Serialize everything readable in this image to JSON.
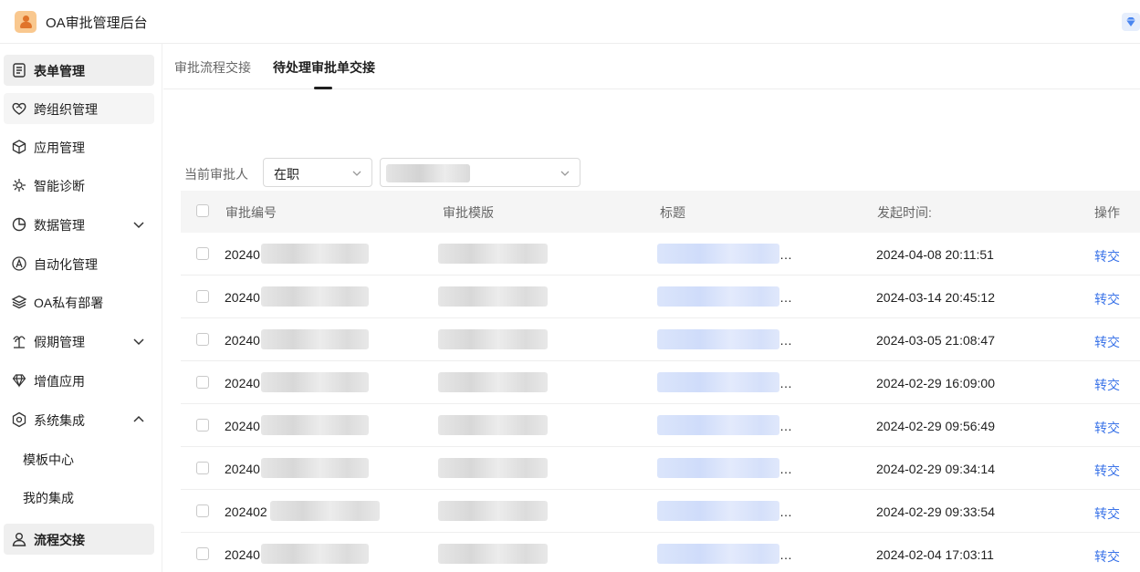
{
  "app": {
    "title": "OA审批管理后台"
  },
  "sidebar": {
    "items": [
      {
        "label": "表单管理",
        "icon": "form-icon"
      },
      {
        "label": "跨组织管理",
        "icon": "heart-handshake-icon"
      },
      {
        "label": "应用管理",
        "icon": "cube-icon"
      },
      {
        "label": "智能诊断",
        "icon": "diagnosis-icon"
      },
      {
        "label": "数据管理",
        "icon": "pie-chart-icon",
        "expanded": false
      },
      {
        "label": "自动化管理",
        "icon": "automation-icon"
      },
      {
        "label": "OA私有部署",
        "icon": "layers-icon"
      },
      {
        "label": "假期管理",
        "icon": "palm-tree-icon",
        "expanded": false
      },
      {
        "label": "增值应用",
        "icon": "diamond-icon"
      },
      {
        "label": "系统集成",
        "icon": "hexagon-settings-icon",
        "expanded": true
      },
      {
        "label": "流程交接",
        "icon": "user-icon",
        "active": true
      }
    ],
    "sub_items": [
      {
        "label": "模板中心"
      },
      {
        "label": "我的集成"
      }
    ]
  },
  "tabs": [
    {
      "label": "审批流程交接",
      "active": false
    },
    {
      "label": "待处理审批单交接",
      "active": true
    }
  ],
  "filter": {
    "label": "当前审批人",
    "status_value": "在职",
    "person_value": ""
  },
  "table": {
    "headers": {
      "id": "审批编号",
      "template": "审批模版",
      "title": "标题",
      "time": "发起时间:",
      "action": "操作"
    },
    "rows": [
      {
        "id_prefix": "20240",
        "time": "2024-04-08 20:11:51",
        "action": "转交"
      },
      {
        "id_prefix": "20240",
        "time": "2024-03-14 20:45:12",
        "action": "转交"
      },
      {
        "id_prefix": "20240",
        "time": "2024-03-05 21:08:47",
        "action": "转交"
      },
      {
        "id_prefix": "20240",
        "time": "2024-02-29 16:09:00",
        "action": "转交"
      },
      {
        "id_prefix": "20240",
        "time": "2024-02-29 09:56:49",
        "action": "转交"
      },
      {
        "id_prefix": "20240",
        "time": "2024-02-29 09:34:14",
        "action": "转交"
      },
      {
        "id_prefix": "202402",
        "time": "2024-02-29 09:33:54",
        "action": "转交"
      },
      {
        "id_prefix": "20240",
        "time": "2024-02-04 17:03:11",
        "action": "转交"
      }
    ]
  },
  "colors": {
    "accent": "#3a73e8",
    "active_bg": "#efefef",
    "header_bg": "#f5f5f5"
  }
}
